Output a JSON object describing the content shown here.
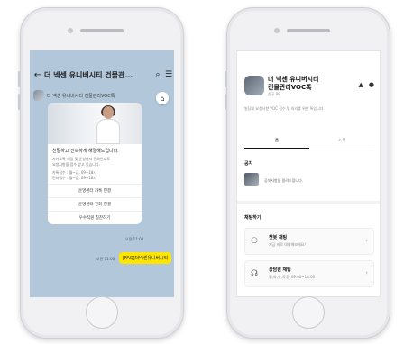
{
  "chat": {
    "title": "더 넥센 유니버시티 건물관...",
    "sender": "더 넥센 유니버시티 건물관리VOC톡",
    "greeting": "친절하고 신속하게 해결해드립니다.",
    "desc_1": "카카오톡 채팅 및 운영센터 전화번호로",
    "desc_2": "요청사항을 접수 받고 있습니다.",
    "hours_1": "카톡접수 : 월~금, 09~18시",
    "hours_2": "전화접수 : 월~금, 09~18시",
    "buttons": [
      "운영센터 카톡 연결",
      "운영센터 전화 연결",
      "우수직원 칭찬하기"
    ],
    "time_1": "오전 11:00",
    "faq_label": "[FAQ]더넥센유니버시티",
    "time_2": "오전 11:00"
  },
  "profile": {
    "name_line1": "더 넥센 유니버시티",
    "name_line2": "건물관리VOC톡",
    "friends": "친구 98",
    "description": "빌딩내 요청사항 VOC 접수 및 처리를 위한 톡입니다.",
    "tab_home": "홈",
    "tab_news": "소식",
    "notice_title": "공지",
    "notice_text": "공지사항을 알려드립니다.",
    "chat_section": "채팅하기",
    "channels": [
      {
        "title": "챗봇 채팅",
        "sub": "지금 바로 대화해보세요!"
      },
      {
        "title": "상담원 채팅",
        "sub": "월,화,수,목,금 09:00~18:00"
      }
    ]
  },
  "icons": {
    "back": "arrow-left-icon",
    "search": "search-icon",
    "menu": "menu-icon",
    "home": "home-icon",
    "chatbot": "robot-icon",
    "agent": "headset-icon"
  },
  "colors": {
    "chat_bg": "#b2c7da",
    "faq_bubble": "#fee500"
  }
}
